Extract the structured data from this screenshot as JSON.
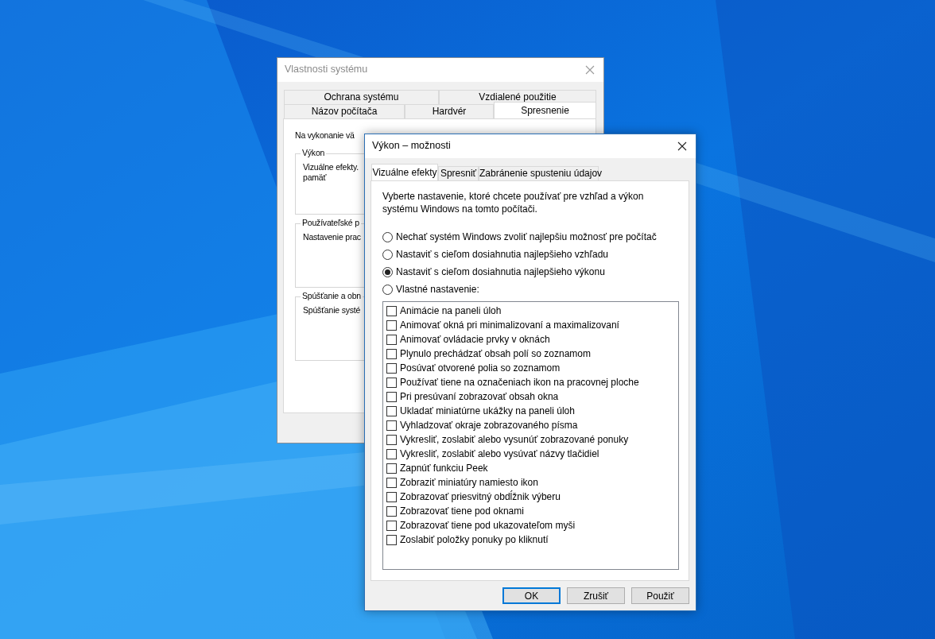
{
  "back_window": {
    "title": "Vlastnosti systému",
    "tab_rows": [
      [
        {
          "label": "Ochrana systému",
          "selected": false
        },
        {
          "label": "Vzdialené použitie",
          "selected": false
        }
      ],
      [
        {
          "label": "Názov počítača",
          "selected": false
        },
        {
          "label": "Hardvér",
          "selected": false
        },
        {
          "label": "Spresnenie",
          "selected": true
        }
      ]
    ],
    "intro": "Na vykonanie vä",
    "groups": [
      {
        "title": "Výkon",
        "lines": [
          "Vizuálne efekty.",
          "pamäť"
        ]
      },
      {
        "title": "Používateľské p",
        "lines": [
          "Nastavenie prac"
        ]
      },
      {
        "title": "Spúšťanie a obn",
        "lines": [
          "Spúšťanie systé"
        ]
      }
    ]
  },
  "front_window": {
    "title": "Výkon – možnosti",
    "tabs": [
      {
        "label": "Vizuálne efekty",
        "selected": true
      },
      {
        "label": "Spresniť",
        "selected": false
      },
      {
        "label": "Zabránenie spusteniu údajov",
        "selected": false
      }
    ],
    "description": "Vyberte nastavenie, ktoré chcete používať pre vzhľad a výkon systému Windows na tomto počítači.",
    "options": [
      {
        "label": "Nechať systém Windows zvoliť najlepšiu možnosť pre počítač",
        "selected": false
      },
      {
        "label": "Nastaviť s cieľom dosiahnutia najlepšieho vzhľadu",
        "selected": false
      },
      {
        "label": "Nastaviť s cieľom dosiahnutia najlepšieho výkonu",
        "selected": true
      },
      {
        "label": "Vlastné nastavenie:",
        "selected": false
      }
    ],
    "effects": [
      {
        "label": "Animácie na paneli úloh",
        "checked": false
      },
      {
        "label": "Animovať okná pri minimalizovaní a maximalizovaní",
        "checked": false
      },
      {
        "label": "Animovať ovládacie prvky v oknách",
        "checked": false
      },
      {
        "label": "Plynulo prechádzať obsah polí so zoznamom",
        "checked": false
      },
      {
        "label": "Posúvať otvorené polia so zoznamom",
        "checked": false
      },
      {
        "label": "Používať tiene na označeniach ikon na pracovnej ploche",
        "checked": false
      },
      {
        "label": "Pri presúvaní zobrazovať obsah okna",
        "checked": false
      },
      {
        "label": "Ukladať miniatúrne ukážky na paneli úloh",
        "checked": false
      },
      {
        "label": "Vyhladzovať okraje zobrazovaného písma",
        "checked": false
      },
      {
        "label": "Vykresliť, zoslabiť alebo vysunúť zobrazované ponuky",
        "checked": false
      },
      {
        "label": "Vykresliť, zoslabiť alebo vysúvať názvy tlačidiel",
        "checked": false
      },
      {
        "label": "Zapnúť funkciu Peek",
        "checked": false
      },
      {
        "label": "Zobraziť miniatúry namiesto ikon",
        "checked": false
      },
      {
        "label": "Zobrazovať priesvitný obdĺžnik výberu",
        "checked": false
      },
      {
        "label": "Zobrazovať tiene pod oknami",
        "checked": false
      },
      {
        "label": "Zobrazovať tiene pod ukazovateľom myši",
        "checked": false
      },
      {
        "label": "Zoslabiť položky ponuky po kliknutí",
        "checked": false
      }
    ],
    "buttons": [
      {
        "label": "OK",
        "default": true
      },
      {
        "label": "Zrušiť",
        "default": false
      },
      {
        "label": "Použiť",
        "default": false
      }
    ]
  }
}
